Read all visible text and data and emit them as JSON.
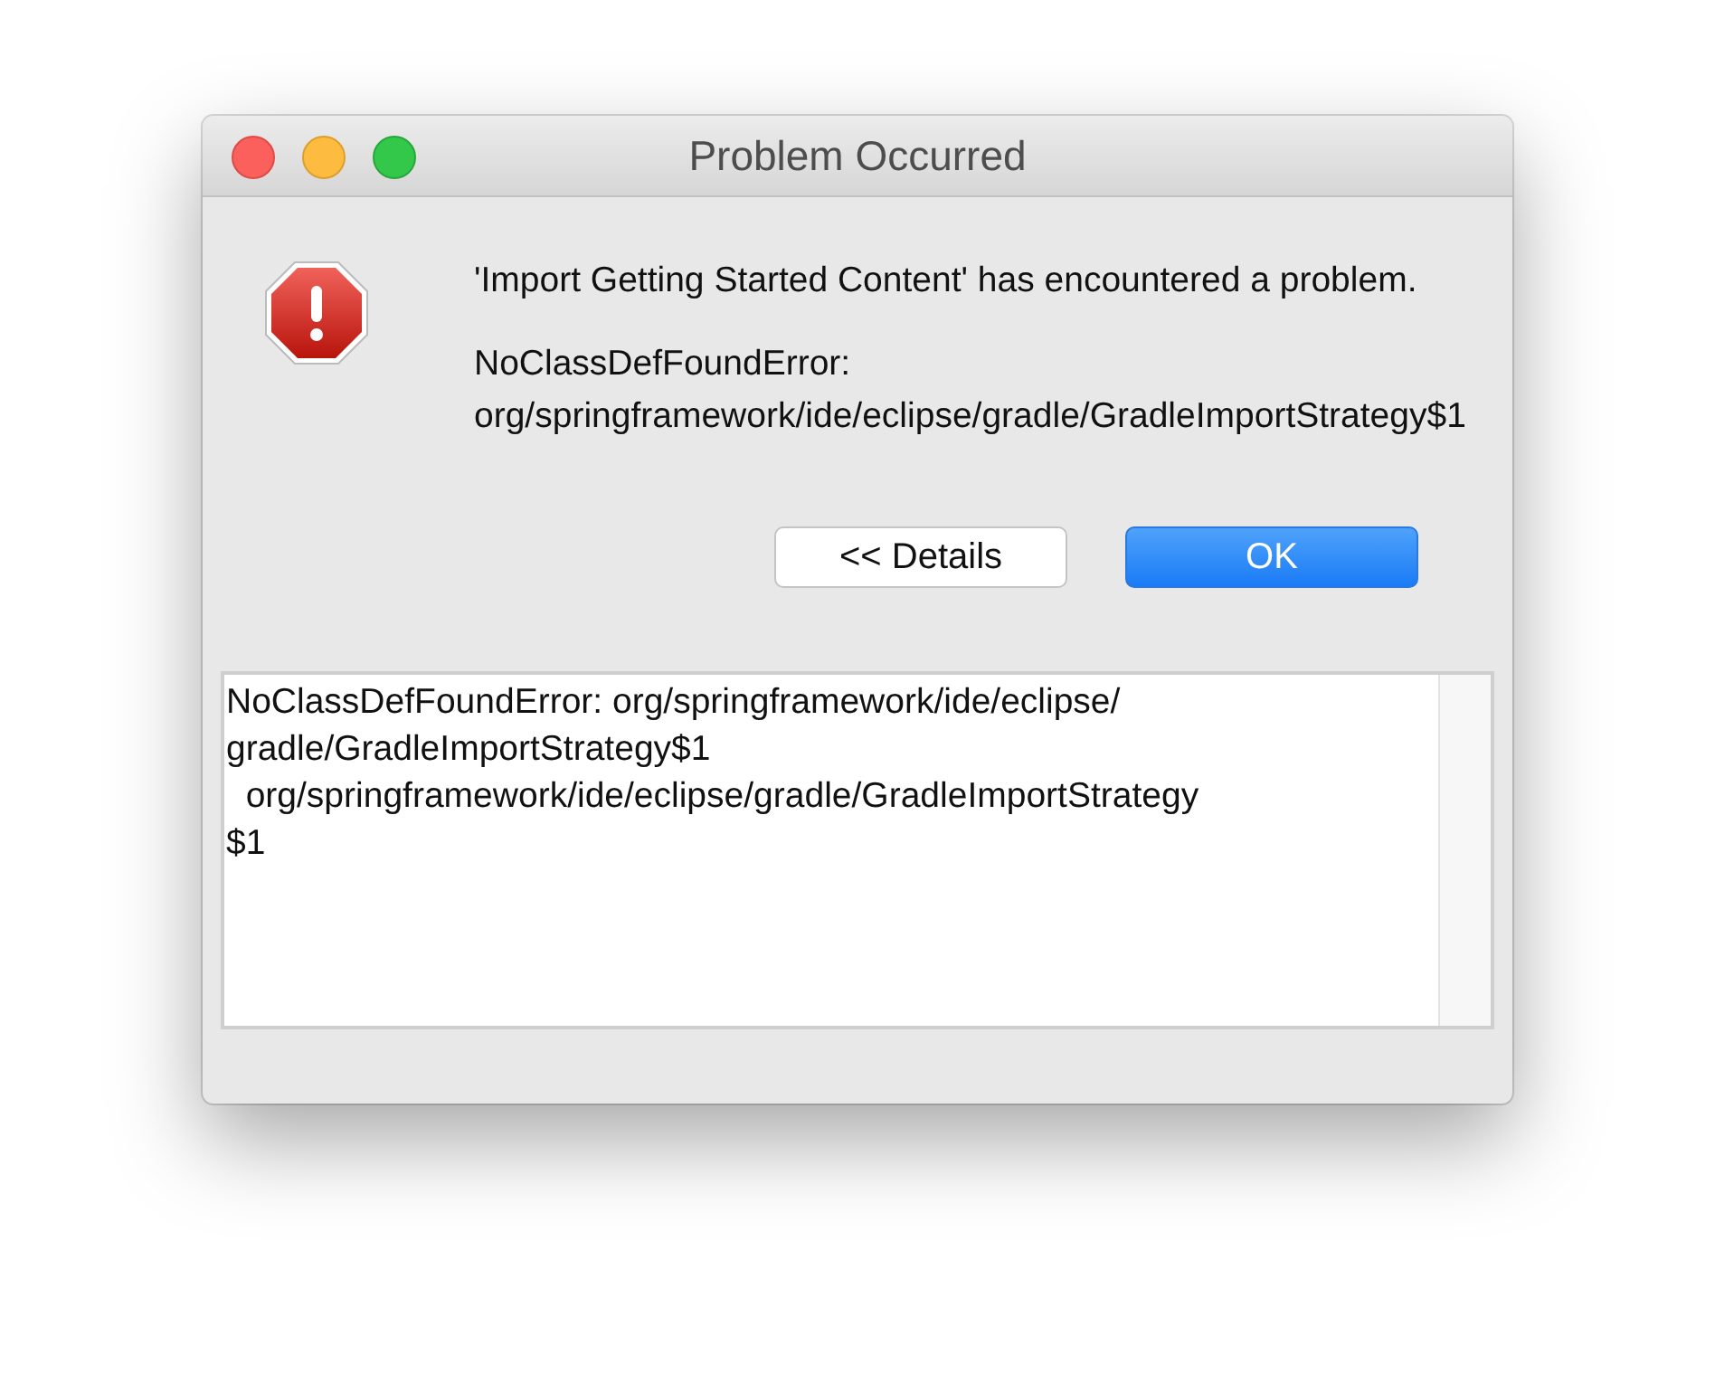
{
  "window": {
    "title": "Problem Occurred"
  },
  "message": {
    "summary": "'Import Getting Started Content' has encountered a problem.",
    "error": "NoClassDefFoundError: org/springframework/ide/eclipse/gradle/GradleImportStrategy$1"
  },
  "buttons": [
    {
      "label": "<< Details",
      "default": false
    },
    {
      "label": "OK",
      "default": true
    }
  ],
  "details": {
    "lines": [
      "NoClassDefFoundError: org/springframework/ide/eclipse/",
      "gradle/GradleImportStrategy$1",
      "  org/springframework/ide/eclipse/gradle/GradleImportStrategy",
      "$1"
    ]
  }
}
